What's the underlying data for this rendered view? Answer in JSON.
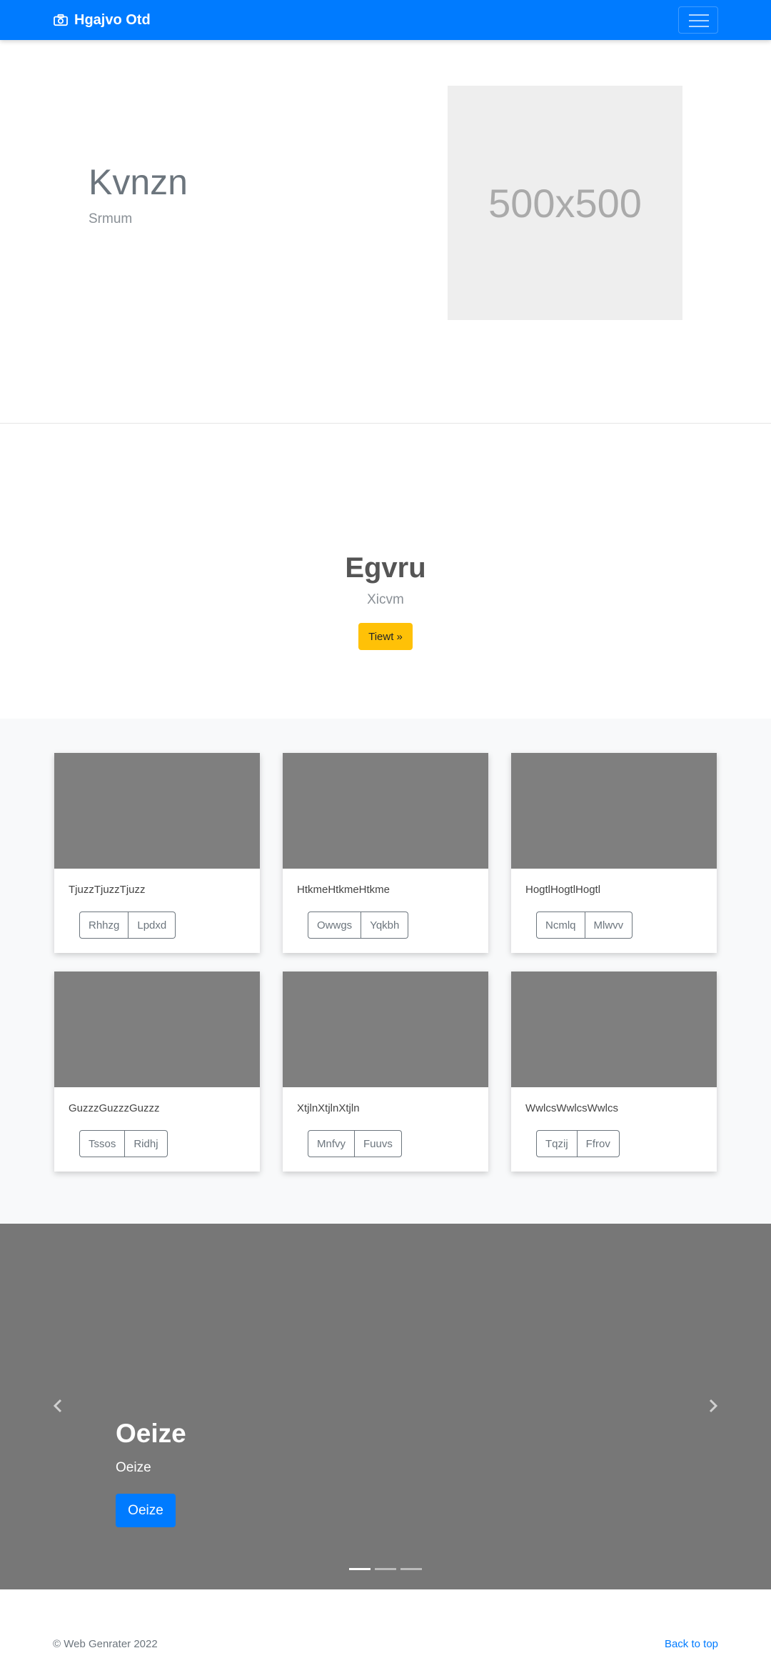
{
  "navbar": {
    "brand": "Hgajvo Otd",
    "brand_icon": "camera-icon",
    "toggler_icon": "hamburger-icon",
    "color": "#007bff"
  },
  "hero": {
    "title": "Kvnzn",
    "subtitle": "Srmum",
    "placeholder_text": "500x500"
  },
  "cta": {
    "title": "Egvru",
    "subtitle": "Xicvm",
    "button": "Tiewt »",
    "button_color": "#ffc107"
  },
  "cards": [
    {
      "text": "TjuzzTjuzzTjuzz",
      "buttons": [
        "Rhhzg",
        "Lpdxd"
      ]
    },
    {
      "text": "HtkmeHtkmeHtkme",
      "buttons": [
        "Owwgs",
        "Yqkbh"
      ]
    },
    {
      "text": "HogtlHogtlHogtl",
      "buttons": [
        "Ncmlq",
        "Mlwvv"
      ]
    },
    {
      "text": "GuzzzGuzzzGuzzz",
      "buttons": [
        "Tssos",
        "Ridhj"
      ]
    },
    {
      "text": "XtjlnXtjlnXtjln",
      "buttons": [
        "Mnfvy",
        "Fuuvs"
      ]
    },
    {
      "text": "WwlcsWwlcsWwlcs",
      "buttons": [
        "Tqzij",
        "Ffrov"
      ]
    }
  ],
  "carousel": {
    "title": "Oeize",
    "subtitle": "Oeize",
    "button": "Oeize",
    "prev_icon": "chevron-left-icon",
    "next_icon": "chevron-right-icon",
    "slide_count": 3,
    "active_slide": 1
  },
  "footer": {
    "copyright": "© Web Genrater 2022",
    "back_to_top": "Back to top"
  }
}
